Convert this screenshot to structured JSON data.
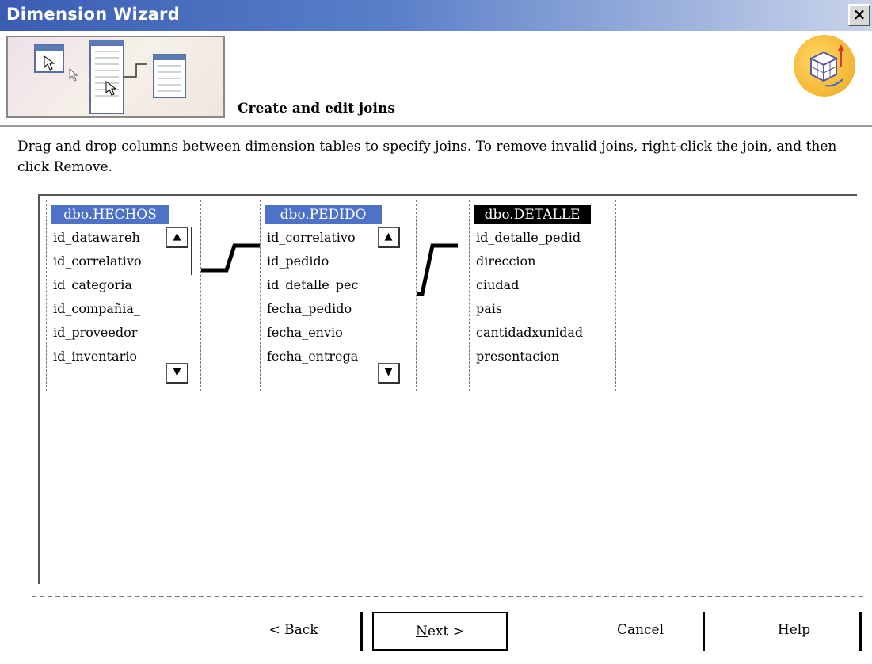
{
  "window": {
    "title": "Dimension Wizard",
    "close_label": "×"
  },
  "header": {
    "title": "Create and edit joins",
    "illustration_icon": "table-diagram-icon",
    "wizard_icon": "cube-icon"
  },
  "instructions": "Drag and drop columns between dimension tables to specify joins. To remove invalid joins, right-click the join, and then click Remove.",
  "tables": [
    {
      "name": "dbo.HECHOS",
      "selected": false,
      "columns": [
        "id_datawareh",
        "id_correlativo",
        "id_categoria",
        "id_compañia_",
        "id_proveedor",
        "id_inventario"
      ]
    },
    {
      "name": "dbo.PEDIDO",
      "selected": false,
      "columns": [
        "id_correlativo",
        "id_pedido",
        "id_detalle_pec",
        "fecha_pedido",
        "fecha_envio",
        "fecha_entrega"
      ]
    },
    {
      "name": "dbo.DETALLE",
      "selected": true,
      "columns": [
        "id_detalle_pedid",
        "direccion",
        "ciudad",
        "pais",
        "cantidadxunidad",
        "presentacion"
      ]
    }
  ],
  "buttons": {
    "back": {
      "prefix": "< ",
      "mnemonic": "B",
      "rest": "ack"
    },
    "next": {
      "mnemonic": "N",
      "rest": "ext >"
    },
    "cancel": {
      "label": "Cancel"
    },
    "help": {
      "mnemonic": "H",
      "rest": "elp"
    }
  },
  "colors": {
    "title_gradient_start": "#3a5db3",
    "table_header_blue": "#4d72c8",
    "table_header_selected": "#000000",
    "wizard_icon_bg": "#f3b230"
  }
}
